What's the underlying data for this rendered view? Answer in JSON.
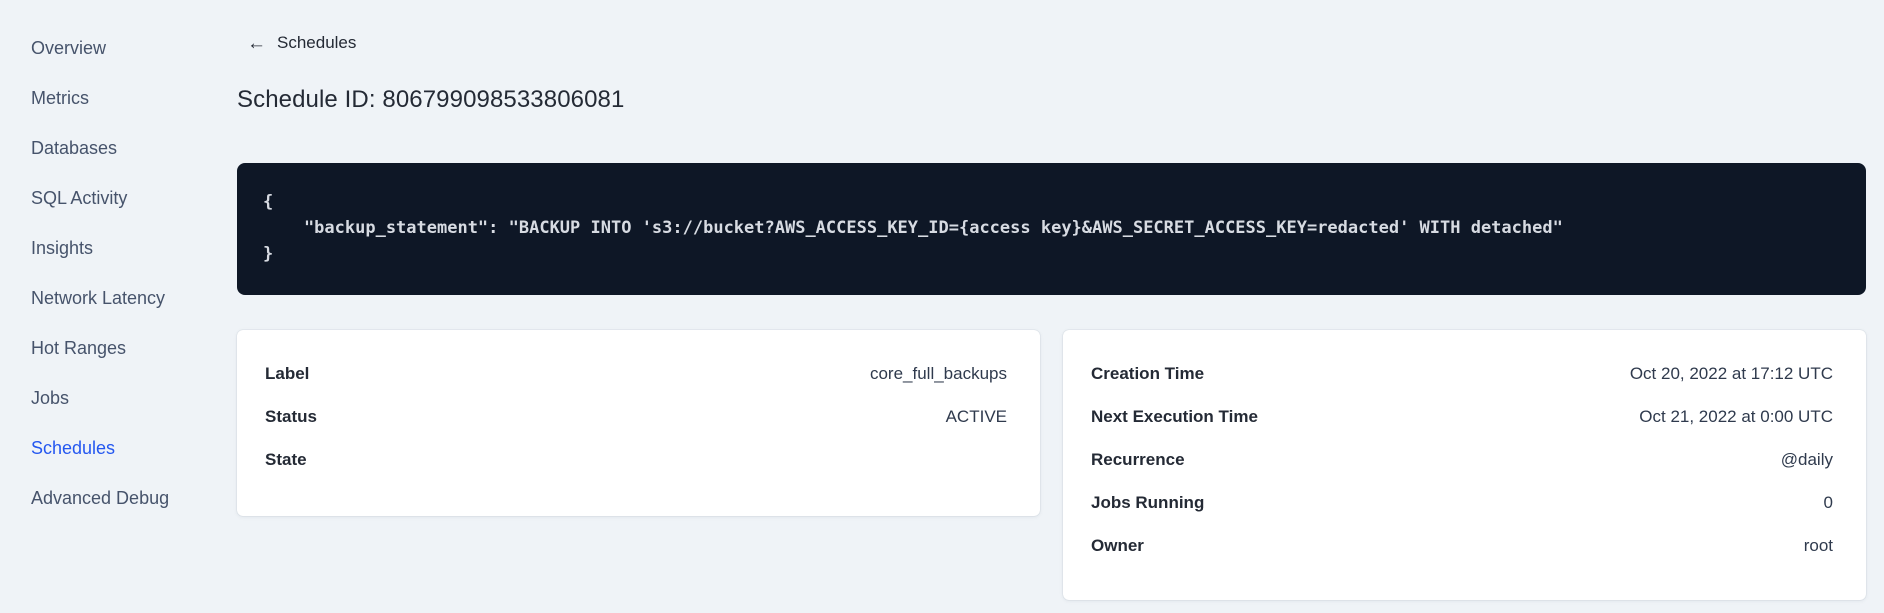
{
  "colors": {
    "accent_blue": "#2457f0",
    "page_background": "#eff3f7",
    "code_block_background": "#0e1726",
    "code_text": "#d7dbe2",
    "text_dark": "#242a35"
  },
  "sidebar": {
    "items": [
      {
        "label": "Overview",
        "active": false
      },
      {
        "label": "Metrics",
        "active": false
      },
      {
        "label": "Databases",
        "active": false
      },
      {
        "label": "SQL Activity",
        "active": false
      },
      {
        "label": "Insights",
        "active": false
      },
      {
        "label": "Network Latency",
        "active": false
      },
      {
        "label": "Hot Ranges",
        "active": false
      },
      {
        "label": "Jobs",
        "active": false
      },
      {
        "label": "Schedules",
        "active": true
      },
      {
        "label": "Advanced Debug",
        "active": false
      }
    ]
  },
  "header": {
    "back_icon": "←",
    "back_label": "Schedules",
    "title": "Schedule ID: 806799098533806081"
  },
  "code_block": {
    "content": "{\n    \"backup_statement\": \"BACKUP INTO 's3://bucket?AWS_ACCESS_KEY_ID={access key}&AWS_SECRET_ACCESS_KEY=redacted' WITH detached\"\n}"
  },
  "cards": {
    "schedule_details": {
      "rows": [
        {
          "label": "Label",
          "value": "core_full_backups"
        },
        {
          "label": "Status",
          "value": "ACTIVE"
        },
        {
          "label": "State",
          "value": ""
        }
      ]
    },
    "execution_details": {
      "rows": [
        {
          "label": "Creation Time",
          "value": "Oct 20, 2022 at 17:12 UTC"
        },
        {
          "label": "Next Execution Time",
          "value": "Oct 21, 2022 at 0:00 UTC"
        },
        {
          "label": "Recurrence",
          "value": "@daily"
        },
        {
          "label": "Jobs Running",
          "value": "0"
        },
        {
          "label": "Owner",
          "value": "root"
        }
      ]
    }
  }
}
